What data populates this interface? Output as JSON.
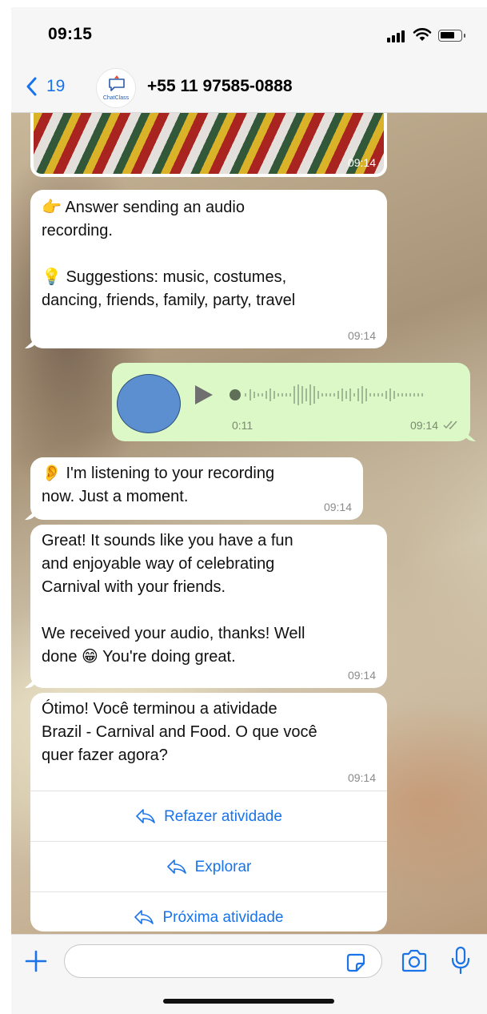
{
  "status_bar": {
    "time": "09:15"
  },
  "header": {
    "back_count": "19",
    "avatar_brand": "ChatClass",
    "contact_number": "+55 11 97585-0888"
  },
  "messages": {
    "photo_time": "09:14",
    "prompt": {
      "text": "👉 Answer sending an audio\nrecording.\n\n💡 Suggestions: music, costumes,\ndancing, friends, family, party, travel",
      "time": "09:14"
    },
    "audio": {
      "duration": "0:11",
      "time": "09:14"
    },
    "listening": {
      "text": "👂 I'm listening to your recording\nnow. Just a moment.",
      "time": "09:14"
    },
    "feedback": {
      "text": "Great! It sounds like you have a fun\nand enjoyable way of celebrating\nCarnival with your friends.\n\nWe received your audio, thanks! Well\ndone 😁 You're doing great.",
      "time": "09:14"
    },
    "completion": {
      "text": "Ótimo! Você terminou a atividade\nBrazil - Carnival and Food. O que você\nquer fazer agora?",
      "time": "09:14",
      "buttons": [
        "Refazer atividade",
        "Explorar",
        "Próxima atividade"
      ]
    }
  },
  "colors": {
    "ios_blue": "#1a73e8",
    "outgoing_bubble": "#dcf8c6",
    "incoming_bubble": "#ffffff",
    "audio_avatar": "#5b8fcf"
  },
  "icons": [
    "back-chevron-icon",
    "plus-icon",
    "sticker-icon",
    "camera-icon",
    "microphone-icon",
    "reply-icon",
    "play-icon",
    "double-check-icon",
    "signal-icon",
    "wifi-icon",
    "battery-icon"
  ]
}
